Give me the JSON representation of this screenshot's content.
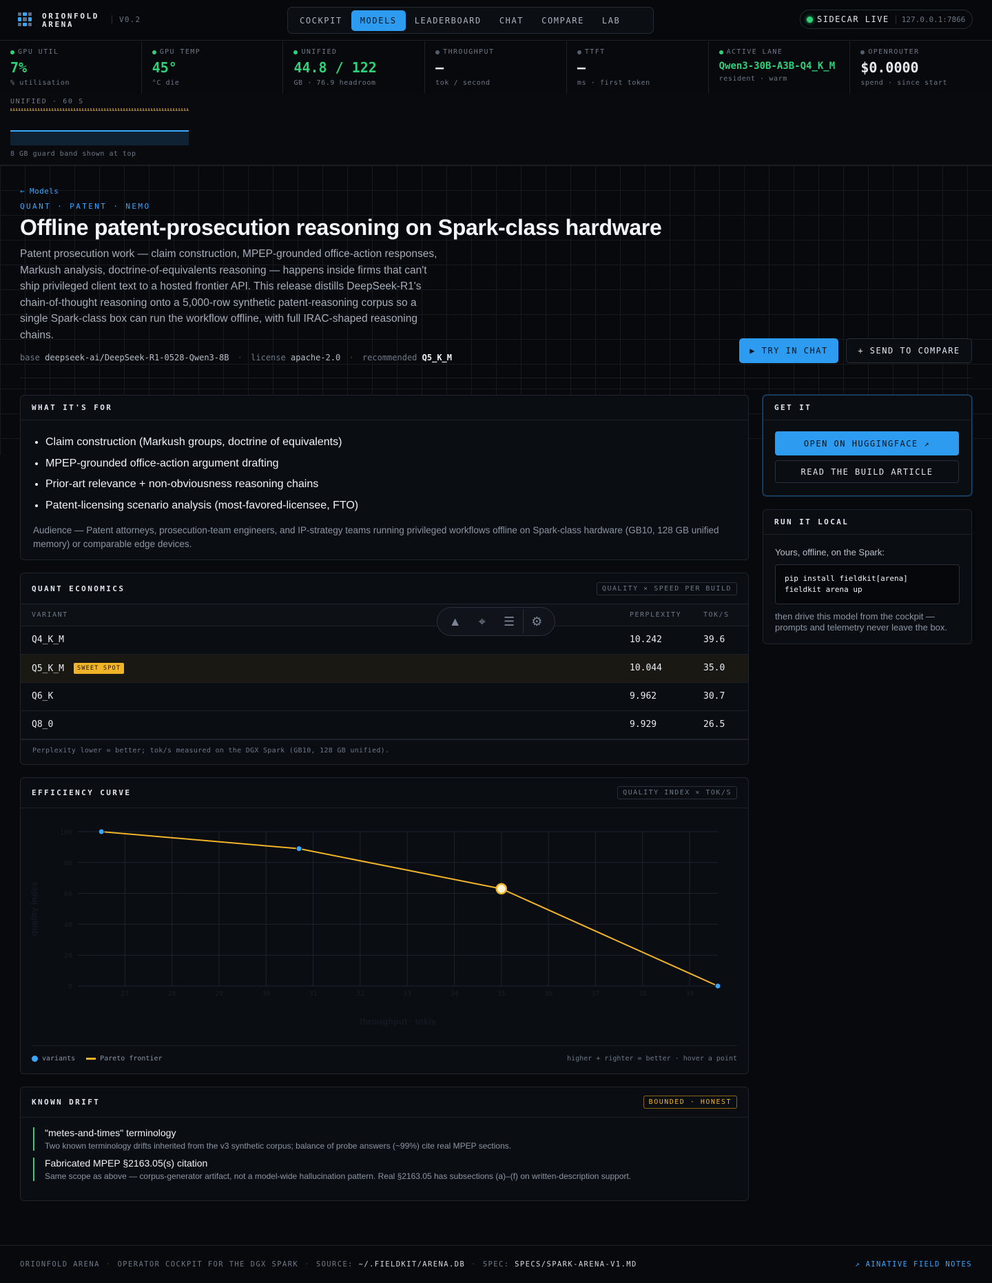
{
  "app": {
    "brand_line1": "ORIONFOLD",
    "brand_line2": "ARENA",
    "version": "V0.2"
  },
  "nav": {
    "tabs": [
      "COCKPIT",
      "MODELS",
      "LEADERBOARD",
      "CHAT",
      "COMPARE",
      "LAB"
    ],
    "active": "MODELS"
  },
  "sidecar": {
    "label": "SIDECAR LIVE",
    "address": "127.0.0.1:7866"
  },
  "metrics": [
    {
      "label": "GPU UTIL",
      "value": "7%",
      "sub": "% utilisation"
    },
    {
      "label": "GPU TEMP",
      "value": "45°",
      "sub": "°C die"
    },
    {
      "label": "UNIFIED",
      "value": "44.8 / 122",
      "sub": "GB · 76.9 headroom"
    },
    {
      "label": "THROUGHPUT",
      "value": "—",
      "sub": "tok / second"
    },
    {
      "label": "TTFT",
      "value": "—",
      "sub": "ms · first token"
    },
    {
      "label": "ACTIVE LANE",
      "value": "Qwen3-30B-A3B-Q4_K_M",
      "sub": "resident · warm"
    },
    {
      "label": "OPENROUTER",
      "value": "$0.0000",
      "sub": "spend · since start"
    }
  ],
  "unified_panel": {
    "title": "UNIFIED · 60 S",
    "note": "8 GB guard band shown at top"
  },
  "page": {
    "back": "← Models",
    "crumb": "QUANT · PATENT · NEMO",
    "title": "Offline patent-prosecution reasoning on Spark-class hardware",
    "description": "Patent prosecution work — claim construction, MPEP-grounded office-action responses, Markush analysis, doctrine-of-equivalents reasoning — happens inside firms that can't ship privileged client text to a hosted frontier API. This release distills DeepSeek-R1's chain-of-thought reasoning onto a 5,000-row synthetic patent-reasoning corpus so a single Spark-class box can run the workflow offline, with full IRAC-shaped reasoning chains.",
    "base_label": "base",
    "base": "deepseek-ai/DeepSeek-R1-0528-Qwen3-8B",
    "license_label": "license",
    "license": "apache-2.0",
    "rec_label": "recommended",
    "recommended": "Q5_K_M",
    "try_chat": "▶ TRY IN CHAT",
    "send_compare": "+ SEND TO COMPARE"
  },
  "what": {
    "title": "WHAT IT'S FOR",
    "items": [
      "Claim construction (Markush groups, doctrine of equivalents)",
      "MPEP-grounded office-action argument drafting",
      "Prior-art relevance + non-obviousness reasoning chains",
      "Patent-licensing scenario analysis (most-favored-licensee, FTO)"
    ],
    "audience": "Audience — Patent attorneys, prosecution-team engineers, and IP-strategy teams running privileged workflows offline on Spark-class hardware (GB10, 128 GB unified memory) or comparable edge devices."
  },
  "getit": {
    "title": "GET IT",
    "hf": "OPEN ON HUGGINGFACE ↗",
    "article": "READ THE BUILD ARTICLE"
  },
  "local": {
    "title": "RUN IT LOCAL",
    "intro": "Yours, offline, on the Spark:",
    "code": "pip install fieldkit[arena]\nfieldkit arena up",
    "after": "then drive this model from the cockpit — prompts and telemetry never leave the box."
  },
  "quant": {
    "title": "QUANT ECONOMICS",
    "badge": "QUALITY × SPEED PER BUILD",
    "headers": [
      "VARIANT",
      "PERPLEXITY",
      "TOK/S"
    ],
    "sweet_label": "SWEET SPOT",
    "rows": [
      {
        "variant": "Q4_K_M",
        "ppl": "10.242",
        "tps": "39.6"
      },
      {
        "variant": "Q5_K_M",
        "ppl": "10.044",
        "tps": "35.0"
      },
      {
        "variant": "Q6_K",
        "ppl": "9.962",
        "tps": "30.7"
      },
      {
        "variant": "Q8_0",
        "ppl": "9.929",
        "tps": "26.5"
      }
    ],
    "note": "Perplexity lower = better; tok/s measured on the DGX Spark (GB10, 128 GB unified)."
  },
  "efficiency": {
    "title": "EFFICIENCY CURVE",
    "badge": "QUALITY INDEX × TOK/S",
    "legend_variants": "variants",
    "legend_frontier": "Pareto frontier",
    "hint": "higher + righter = better · hover a point"
  },
  "chart_data": {
    "type": "line",
    "xlabel": "throughput · tok/s",
    "ylabel": "quality index",
    "xlim": [
      26,
      39.6
    ],
    "ylim": [
      0,
      100
    ],
    "x_ticks": [
      27,
      28,
      29,
      30,
      31,
      32,
      33,
      34,
      35,
      36,
      37,
      38,
      39
    ],
    "y_ticks": [
      0,
      20,
      40,
      60,
      80,
      100
    ],
    "series": [
      {
        "name": "Pareto frontier",
        "points": [
          {
            "label": "Q8_0",
            "x": 26.5,
            "y": 100
          },
          {
            "label": "Q6_K",
            "x": 30.7,
            "y": 89
          },
          {
            "label": "Q5_K_M",
            "x": 35.0,
            "y": 63
          },
          {
            "label": "Q4_K_M",
            "x": 39.6,
            "y": 0
          }
        ]
      }
    ],
    "highlight": "Q5_K_M",
    "colors": {
      "line": "#f0b429",
      "point": "#3aa6ff",
      "highlight": "#f0b429"
    }
  },
  "drift": {
    "title": "KNOWN DRIFT",
    "badge": "BOUNDED · HONEST",
    "items": [
      {
        "title": "\"metes-and-times\" terminology",
        "desc": "Two known terminology drifts inherited from the v3 synthetic corpus; balance of probe answers (~99%) cite real MPEP sections."
      },
      {
        "title": "Fabricated MPEP §2163.05(s) citation",
        "desc": "Same scope as above — corpus-generator artifact, not a model-wide hallucination pattern. Real §2163.05 has subsections (a)–(f) on written-description support."
      }
    ]
  },
  "footer": {
    "name": "ORIONFOLD ARENA",
    "tagline": "OPERATOR COCKPIT FOR THE DGX SPARK",
    "source_label": "SOURCE:",
    "source": "~/.FIELDKIT/ARENA.DB",
    "spec_label": "SPEC:",
    "spec": "SPECS/SPARK-ARENA-V1.MD",
    "link": "↗ AINATIVE FIELD NOTES"
  },
  "toolbar": {
    "icons": [
      "astro-icon",
      "cursor-select-icon",
      "search-list-icon",
      "gear-icon"
    ]
  }
}
